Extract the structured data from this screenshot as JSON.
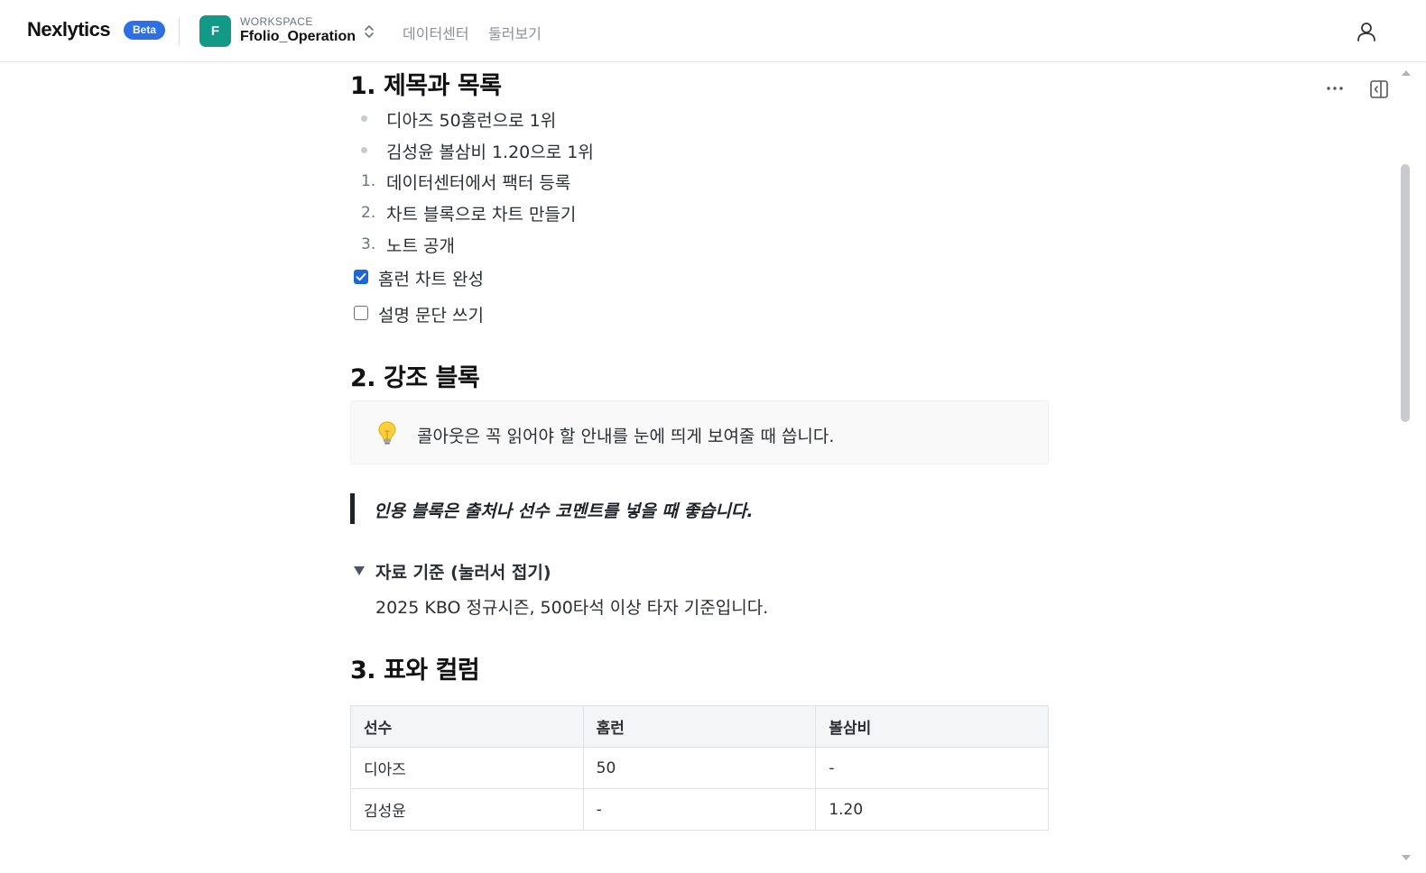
{
  "header": {
    "brand": "Nexlytics",
    "badge": "Beta",
    "workspace": {
      "initial": "F",
      "caption": "WORKSPACE",
      "name": "Ffolio_Operation"
    },
    "nav": [
      "데이터센터",
      "둘러보기"
    ]
  },
  "doc": {
    "section1": {
      "title": "1. 제목과 목록",
      "bullets": [
        "디아즈 50홈런으로 1위",
        "김성윤 볼삼비 1.20으로 1위"
      ],
      "numbered": [
        {
          "num": "1.",
          "text": "데이터센터에서 팩터 등록"
        },
        {
          "num": "2.",
          "text": "차트 블록으로 차트 만들기"
        },
        {
          "num": "3.",
          "text": "노트 공개"
        }
      ],
      "todos": [
        {
          "text": "홈런 차트 완성",
          "checked": true
        },
        {
          "text": "설명 문단 쓰기",
          "checked": false
        }
      ]
    },
    "section2": {
      "title": "2. 강조 블록",
      "callout": {
        "icon": "lightbulb-icon",
        "text": "콜아웃은 꼭 읽어야 할 안내를 눈에 띄게 보여줄 때 씁니다."
      },
      "quote": "인용 블록은 출처나 선수 코멘트를 넣을 때 좋습니다.",
      "toggle": {
        "title": "자료 기준 (눌러서 접기)",
        "body": "2025 KBO 정규시즌, 500타석 이상 타자 기준입니다.",
        "expanded": true
      }
    },
    "section3": {
      "title": "3. 표와 컬럼",
      "table": {
        "headers": [
          "선수",
          "홈런",
          "볼삼비"
        ],
        "rows": [
          [
            "디아즈",
            "50",
            "-"
          ],
          [
            "김성윤",
            "-",
            "1.20"
          ]
        ]
      }
    }
  },
  "colors": {
    "accent": "#2f6fe4",
    "workspace": "#129a86",
    "checkbox": "#1b66d8"
  }
}
